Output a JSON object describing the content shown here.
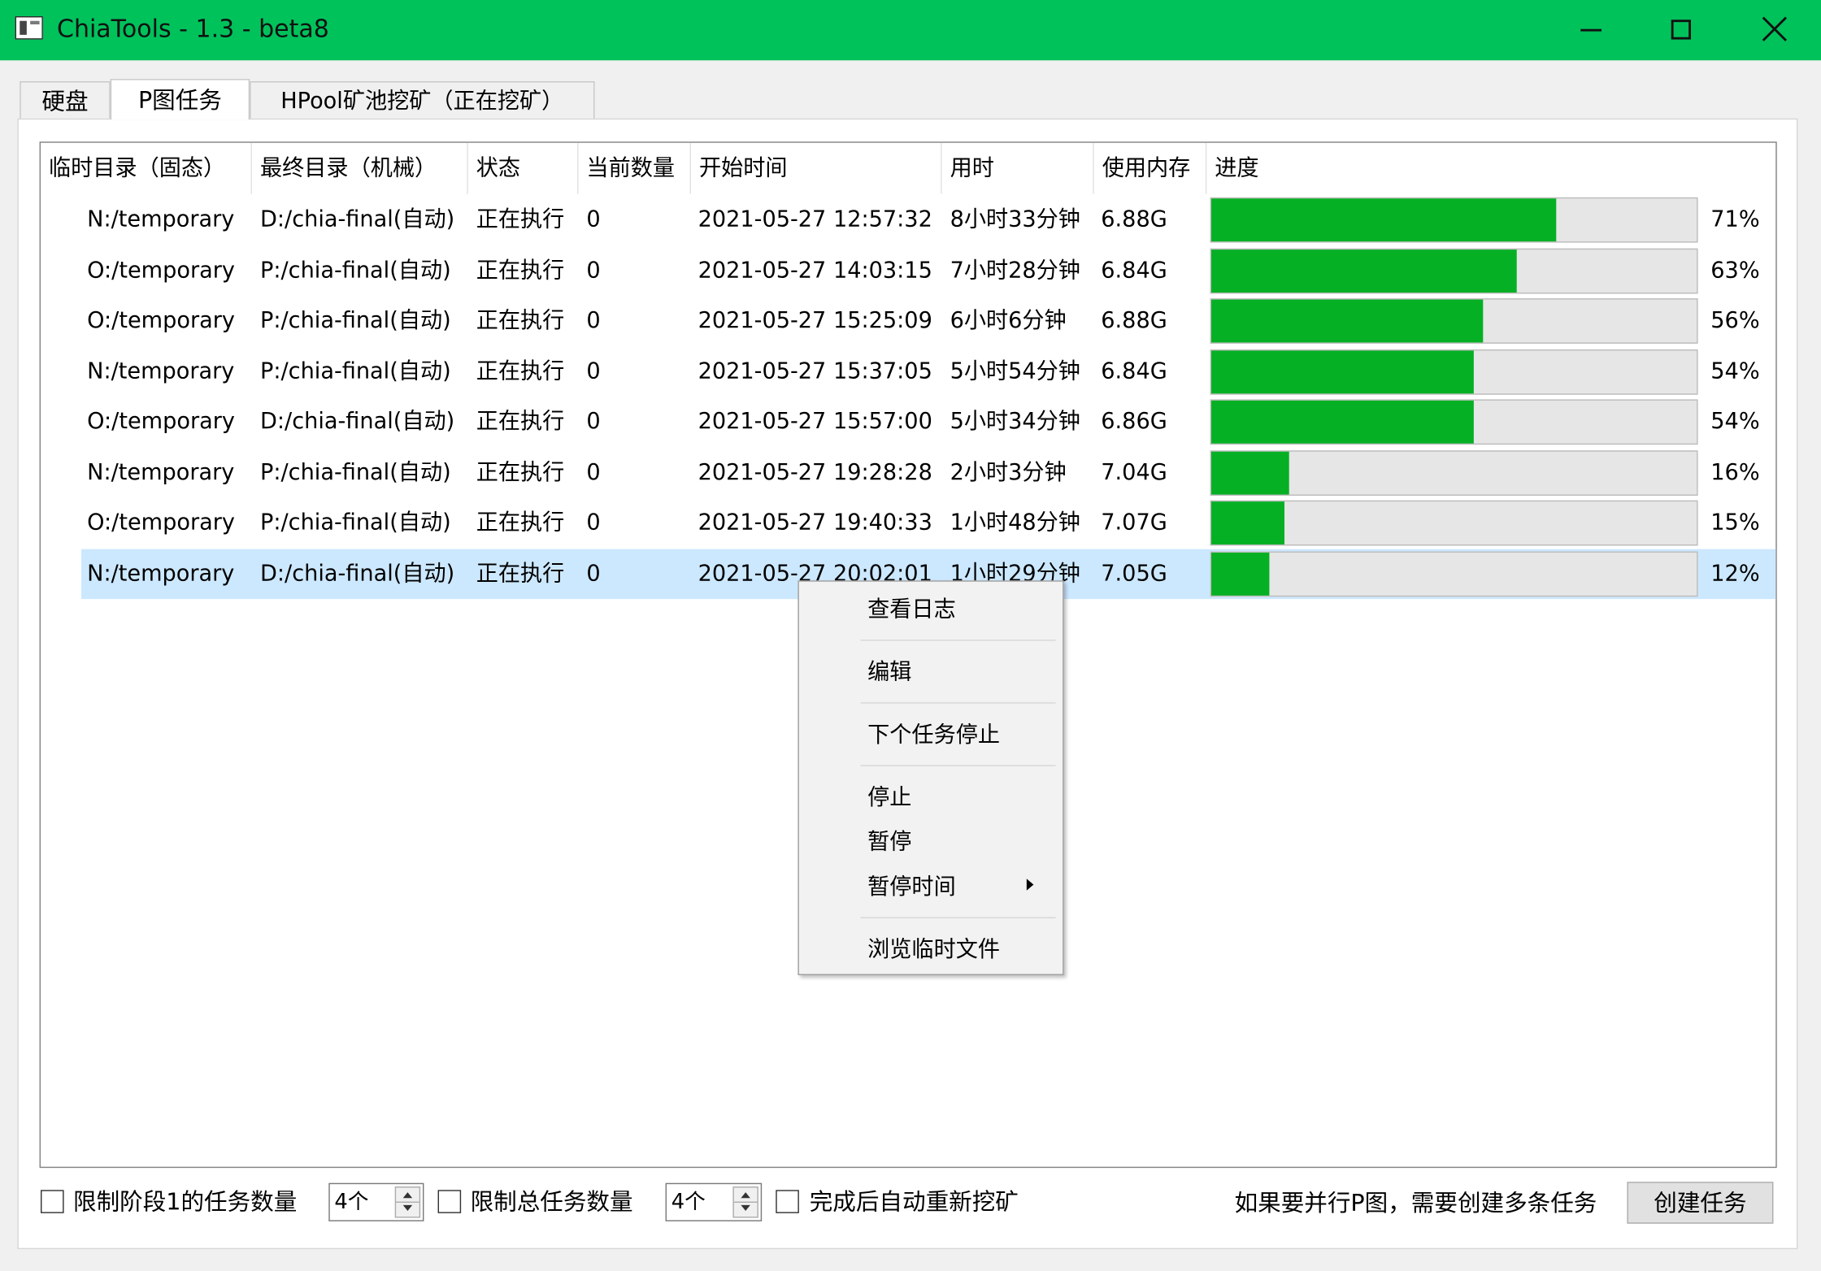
{
  "window": {
    "title": "ChiaTools - 1.3 - beta8",
    "accent": "#00c25b"
  },
  "tabs": [
    {
      "label": "硬盘"
    },
    {
      "label": "P图任务"
    },
    {
      "label": "HPool矿池挖矿（正在挖矿）"
    }
  ],
  "table": {
    "columns": [
      "临时目录（固态）",
      "最终目录（机械）",
      "状态",
      "当前数量",
      "开始时间",
      "用时",
      "使用内存",
      "进度"
    ],
    "rows": [
      {
        "temp": "N:/temporary",
        "final": "D:/chia-final(自动)",
        "status": "正在执行",
        "count": "0",
        "start": "2021-05-27 12:57:32",
        "elapsed": "8小时33分钟",
        "mem": "6.88G",
        "progress": 71,
        "progress_label": "71%"
      },
      {
        "temp": "O:/temporary",
        "final": "P:/chia-final(自动)",
        "status": "正在执行",
        "count": "0",
        "start": "2021-05-27 14:03:15",
        "elapsed": "7小时28分钟",
        "mem": "6.84G",
        "progress": 63,
        "progress_label": "63%"
      },
      {
        "temp": "O:/temporary",
        "final": "P:/chia-final(自动)",
        "status": "正在执行",
        "count": "0",
        "start": "2021-05-27 15:25:09",
        "elapsed": "6小时6分钟",
        "mem": "6.88G",
        "progress": 56,
        "progress_label": "56%"
      },
      {
        "temp": "N:/temporary",
        "final": "P:/chia-final(自动)",
        "status": "正在执行",
        "count": "0",
        "start": "2021-05-27 15:37:05",
        "elapsed": "5小时54分钟",
        "mem": "6.84G",
        "progress": 54,
        "progress_label": "54%"
      },
      {
        "temp": "O:/temporary",
        "final": "D:/chia-final(自动)",
        "status": "正在执行",
        "count": "0",
        "start": "2021-05-27 15:57:00",
        "elapsed": "5小时34分钟",
        "mem": "6.86G",
        "progress": 54,
        "progress_label": "54%"
      },
      {
        "temp": "N:/temporary",
        "final": "P:/chia-final(自动)",
        "status": "正在执行",
        "count": "0",
        "start": "2021-05-27 19:28:28",
        "elapsed": "2小时3分钟",
        "mem": "7.04G",
        "progress": 16,
        "progress_label": "16%"
      },
      {
        "temp": "O:/temporary",
        "final": "P:/chia-final(自动)",
        "status": "正在执行",
        "count": "0",
        "start": "2021-05-27 19:40:33",
        "elapsed": "1小时48分钟",
        "mem": "7.07G",
        "progress": 15,
        "progress_label": "15%"
      },
      {
        "temp": "N:/temporary",
        "final": "D:/chia-final(自动)",
        "status": "正在执行",
        "count": "0",
        "start": "2021-05-27 20:02:01",
        "elapsed": "1小时29分钟",
        "mem": "7.05G",
        "progress": 12,
        "progress_label": "12%"
      }
    ]
  },
  "context_menu": {
    "items": [
      {
        "label": "查看日志"
      },
      {
        "label": "编辑"
      },
      {
        "label": "下个任务停止"
      },
      {
        "label": "停止"
      },
      {
        "label": "暂停"
      },
      {
        "label": "暂停时间"
      },
      {
        "label": "浏览临时文件"
      }
    ]
  },
  "bottom": {
    "limit_phase1_label": "限制阶段1的任务数量",
    "limit_phase1_value": "4个",
    "limit_total_label": "限制总任务数量",
    "limit_total_value": "4个",
    "auto_remine_label": "完成后自动重新挖矿",
    "hint": "如果要并行P图，需要创建多条任务",
    "create_label": "创建任务"
  },
  "colors": {
    "progress_fill": "#06b025",
    "progress_track": "#e6e6e6",
    "selection": "#cce8ff"
  }
}
